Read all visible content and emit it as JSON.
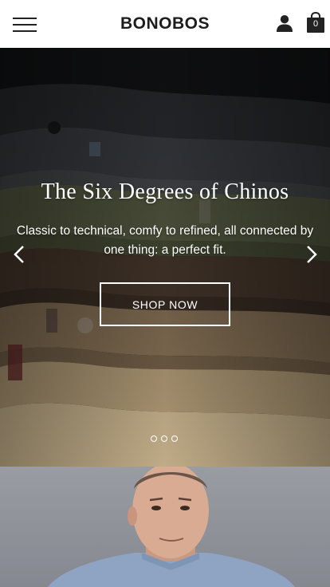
{
  "header": {
    "logo": "BONOBOS",
    "bag_count": "0",
    "icons": [
      "menu-icon",
      "account-icon",
      "shopping-bag-icon"
    ]
  },
  "hero": {
    "title": "The Six Degrees of Chinos",
    "subtitle": "Classic to technical, comfy to refined, all connected by one thing: a perfect fit.",
    "cta_label": "SHOP NOW",
    "slides_total": 3,
    "active_slide": 1
  },
  "colors": {
    "header_bg": "#ffffff",
    "text_dark": "#1d1d1d",
    "hero_text": "#ffffff"
  }
}
